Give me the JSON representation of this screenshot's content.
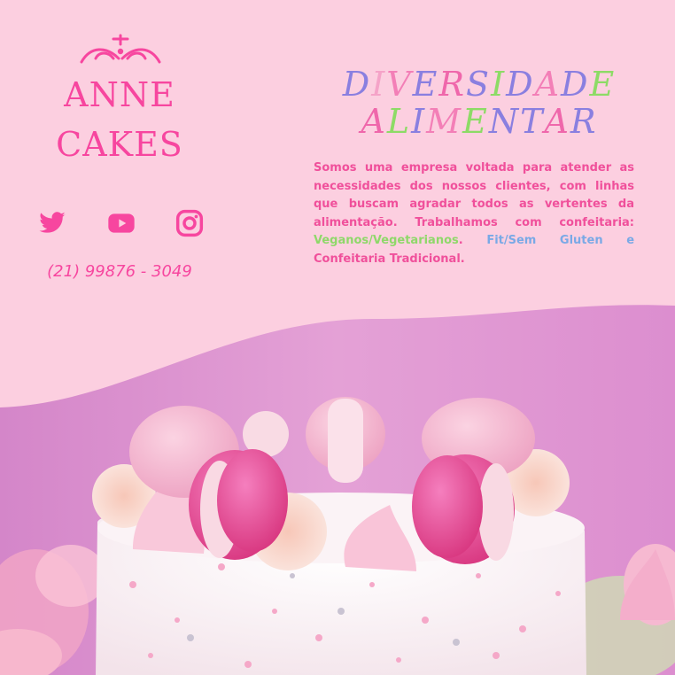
{
  "brand": {
    "line1": "ANNE",
    "line2": "CAKES",
    "color": "#f7469f"
  },
  "social": [
    {
      "name": "twitter-icon"
    },
    {
      "name": "youtube-icon"
    },
    {
      "name": "instagram-icon"
    }
  ],
  "phone": "(21) 99876 - 3049",
  "headline": {
    "line1": [
      "D",
      "I",
      "V",
      "E",
      "R",
      "S",
      "I",
      "D",
      "A",
      "D",
      "E"
    ],
    "line2": [
      "A",
      "L",
      "I",
      "M",
      "E",
      "N",
      "T",
      "A",
      "R"
    ],
    "colors1": [
      "#8a7fe0",
      "#f5a3c8",
      "#f37fb7",
      "#8a7fe0",
      "#ef67ab",
      "#8a7fe0",
      "#8ddb66",
      "#8a7fe0",
      "#f37fb7",
      "#8a7fe0",
      "#8ddb66"
    ],
    "colors2": [
      "#ef67ab",
      "#8ddb66",
      "#8a7fe0",
      "#f37fb7",
      "#8ddb66",
      "#8a7fe0",
      "#8a7fe0",
      "#ef67ab",
      "#8a7fe0"
    ]
  },
  "description": {
    "part1": "Somos uma empresa voltada para atender as necessidades dos nossos clientes, com linhas que buscam agradar todos as vertentes da alimentação. Trabalhamos com confeitaria: ",
    "vegan": "Veganos/Vegetarianos",
    "sep": ". ",
    "fit": "Fit/Sem Gluten e",
    "part2": " Confeitaria Tradicional."
  },
  "colors": {
    "background": "#fccfe0",
    "accent": "#f7469f",
    "green": "#8fd86a",
    "blue": "#7aa9e6"
  }
}
